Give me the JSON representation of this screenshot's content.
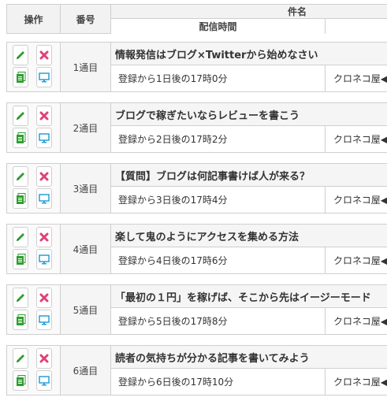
{
  "header": {
    "operation": "操作",
    "number": "番号",
    "subject": "件名",
    "send_time": "配信時間"
  },
  "colors": {
    "edit": "#2e9e2e",
    "delete": "#e0407a",
    "copy": "#2e9e2e",
    "preview": "#2a9fd6",
    "border": "#cfcfcf",
    "header_bg": "#f2f2f2"
  },
  "icons": {
    "edit": "pencil-icon",
    "delete": "close-icon",
    "copy": "document-copy-icon",
    "preview": "monitor-icon"
  },
  "rows": [
    {
      "number": "1通目",
      "subject": "情報発信はブログ×Twitterから始めなさい",
      "time": "登録から1日後の17時0分",
      "sender": "クロネコ屋◀"
    },
    {
      "number": "2通目",
      "subject": "ブログで稼ぎたいならレビューを書こう",
      "time": "登録から2日後の17時2分",
      "sender": "クロネコ屋◀"
    },
    {
      "number": "3通目",
      "subject": "【質問】ブログは何記事書けば人が来る？",
      "time": "登録から3日後の17時4分",
      "sender": "クロネコ屋◀"
    },
    {
      "number": "4通目",
      "subject": "楽して鬼のようにアクセスを集める方法",
      "time": "登録から4日後の17時6分",
      "sender": "クロネコ屋◀"
    },
    {
      "number": "5通目",
      "subject": "「最初の１円」を稼げば、そこから先はイージーモード",
      "time": "登録から5日後の17時8分",
      "sender": "クロネコ屋◀"
    },
    {
      "number": "6通目",
      "subject": "読者の気持ちが分かる記事を書いてみよう",
      "time": "登録から6日後の17時10分",
      "sender": "クロネコ屋◀"
    }
  ]
}
